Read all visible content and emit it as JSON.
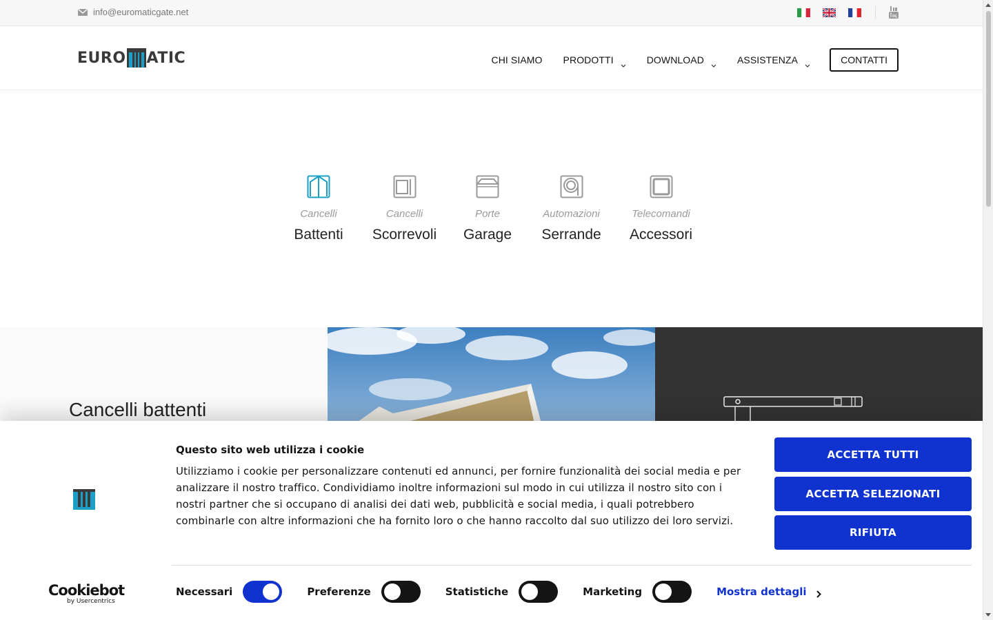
{
  "topbar": {
    "email": "info@euromaticgate.net",
    "flags": [
      "flag-italy-icon",
      "flag-uk-icon",
      "flag-france-icon"
    ],
    "social_icon": "youtube-icon"
  },
  "header": {
    "logo_left": "EURO",
    "logo_right": "ATIC",
    "nav": [
      {
        "label": "CHI SIAMO",
        "dropdown": false
      },
      {
        "label": "PRODOTTI",
        "dropdown": true
      },
      {
        "label": "DOWNLOAD",
        "dropdown": true
      },
      {
        "label": "ASSISTENZA",
        "dropdown": true
      }
    ],
    "contact_label": "CONTATTI"
  },
  "categories": [
    {
      "sub": "Cancelli",
      "main": "Battenti",
      "icon": "swing-gate-icon",
      "active": true
    },
    {
      "sub": "Cancelli",
      "main": "Scorrevoli",
      "icon": "sliding-gate-icon",
      "active": false
    },
    {
      "sub": "Porte",
      "main": "Garage",
      "icon": "garage-door-icon",
      "active": false
    },
    {
      "sub": "Automazioni",
      "main": "Serrande",
      "icon": "roller-shutter-icon",
      "active": false
    },
    {
      "sub": "Telecomandi",
      "main": "Accessori",
      "icon": "remote-control-icon",
      "active": false
    }
  ],
  "feature": {
    "title": "Cancelli battenti"
  },
  "cookie": {
    "heading": "Questo sito web utilizza i cookie",
    "body": "Utilizziamo i cookie per personalizzare contenuti ed annunci, per fornire funzionalità dei social media e per analizzare il nostro traffico. Condividiamo inoltre informazioni sul modo in cui utilizza il nostro sito con i nostri partner che si occupano di analisi dei dati web, pubblicità e social media, i quali potrebbero combinarle con altre informazioni che ha fornito loro o che hanno raccolto dal suo utilizzo dei loro servizi.",
    "buttons": {
      "accept_all": "ACCETTA TUTTI",
      "accept_selected": "ACCETTA SELEZIONATI",
      "reject": "RIFIUTA"
    },
    "brand_name": "Cookiebot",
    "brand_by": "by Usercentrics",
    "toggles": [
      {
        "label": "Necessari",
        "on": true
      },
      {
        "label": "Preferenze",
        "on": false
      },
      {
        "label": "Statistiche",
        "on": false
      },
      {
        "label": "Marketing",
        "on": false
      }
    ],
    "details_label": "Mostra dettagli",
    "colors": {
      "primary": "#1032cf",
      "toggle_off": "#141414",
      "accent_teal": "#1b9fc6"
    }
  }
}
